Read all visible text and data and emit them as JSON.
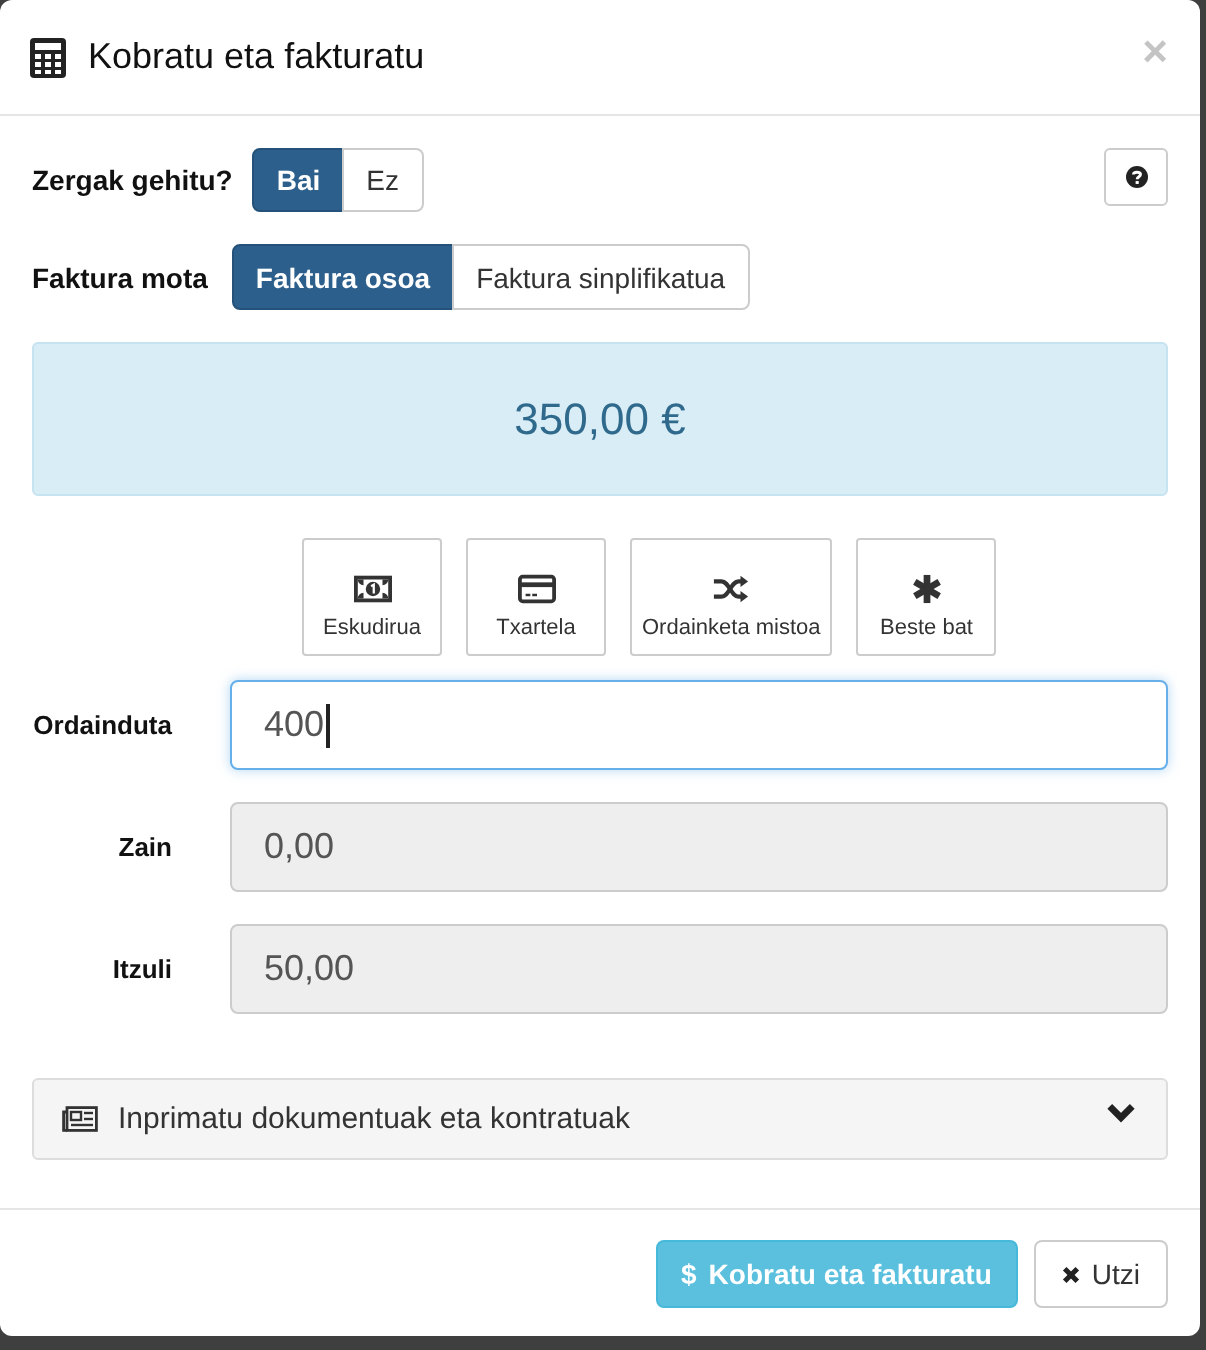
{
  "modal": {
    "title": "Kobratu eta fakturatu",
    "close": "×"
  },
  "tax_row": {
    "label": "Zergak gehitu?",
    "options": [
      {
        "label": "Bai",
        "selected": true
      },
      {
        "label": "Ez",
        "selected": false
      }
    ]
  },
  "invoice_row": {
    "label": "Faktura mota",
    "options": [
      {
        "label": "Faktura osoa",
        "selected": true
      },
      {
        "label": "Faktura sinplifikatua",
        "selected": false
      }
    ]
  },
  "total": "350,00 €",
  "payment_methods": [
    {
      "label": "Eskudirua",
      "kind": "cash"
    },
    {
      "label": "Txartela",
      "kind": "card"
    },
    {
      "label": "Ordainketa mistoa",
      "kind": "mixed"
    },
    {
      "label": "Beste bat",
      "kind": "other"
    }
  ],
  "fields": [
    {
      "label": "Ordainduta",
      "value": "400",
      "readonly": false,
      "focused": true
    },
    {
      "label": "Zain",
      "value": "0,00",
      "readonly": true,
      "focused": false
    },
    {
      "label": "Itzuli",
      "value": "50,00",
      "readonly": true,
      "focused": false
    }
  ],
  "print_panel": {
    "label": "Inprimatu dokumentuak eta kontratuak",
    "expanded": false
  },
  "buttons": [
    {
      "label": "Kobratu eta fakturatu",
      "kind": "primary",
      "symbol": "$"
    },
    {
      "label": "Utzi",
      "kind": "cancel"
    }
  ]
}
